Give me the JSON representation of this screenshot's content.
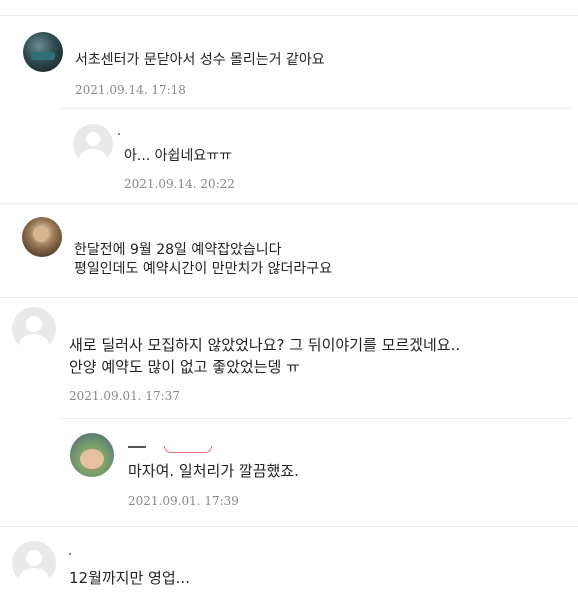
{
  "comments": [
    {
      "text_lines": [
        "서초센터가 문닫아서 성수 몰리는거 같아요"
      ],
      "date": "2021.09.14. 17:18",
      "reply": false
    },
    {
      "text_lines": [
        "아... 아쉽네요ㅠㅠ"
      ],
      "date": "2021.09.14. 20:22",
      "reply": true
    },
    {
      "text_lines": [
        "한달전에 9월 28일 예약잡았습니다",
        "평일인데도 예약시간이 만만치가 않더라구요"
      ],
      "date": "",
      "reply": false
    },
    {
      "text_lines": [
        "새로 딜러사 모집하지 않았었나요? 그 뒤이야기를 모르겠네요..",
        "안양 예약도 많이 없고 좋았었는뎅 ㅠ"
      ],
      "date": "2021.09.01. 17:37",
      "reply": false
    },
    {
      "text_lines": [
        "마자여. 일처리가 깔끔했죠."
      ],
      "date": "2021.09.01. 17:39",
      "reply": true
    },
    {
      "text_lines": [
        "12월까지만 영업..."
      ],
      "date": "",
      "reply": false
    }
  ]
}
